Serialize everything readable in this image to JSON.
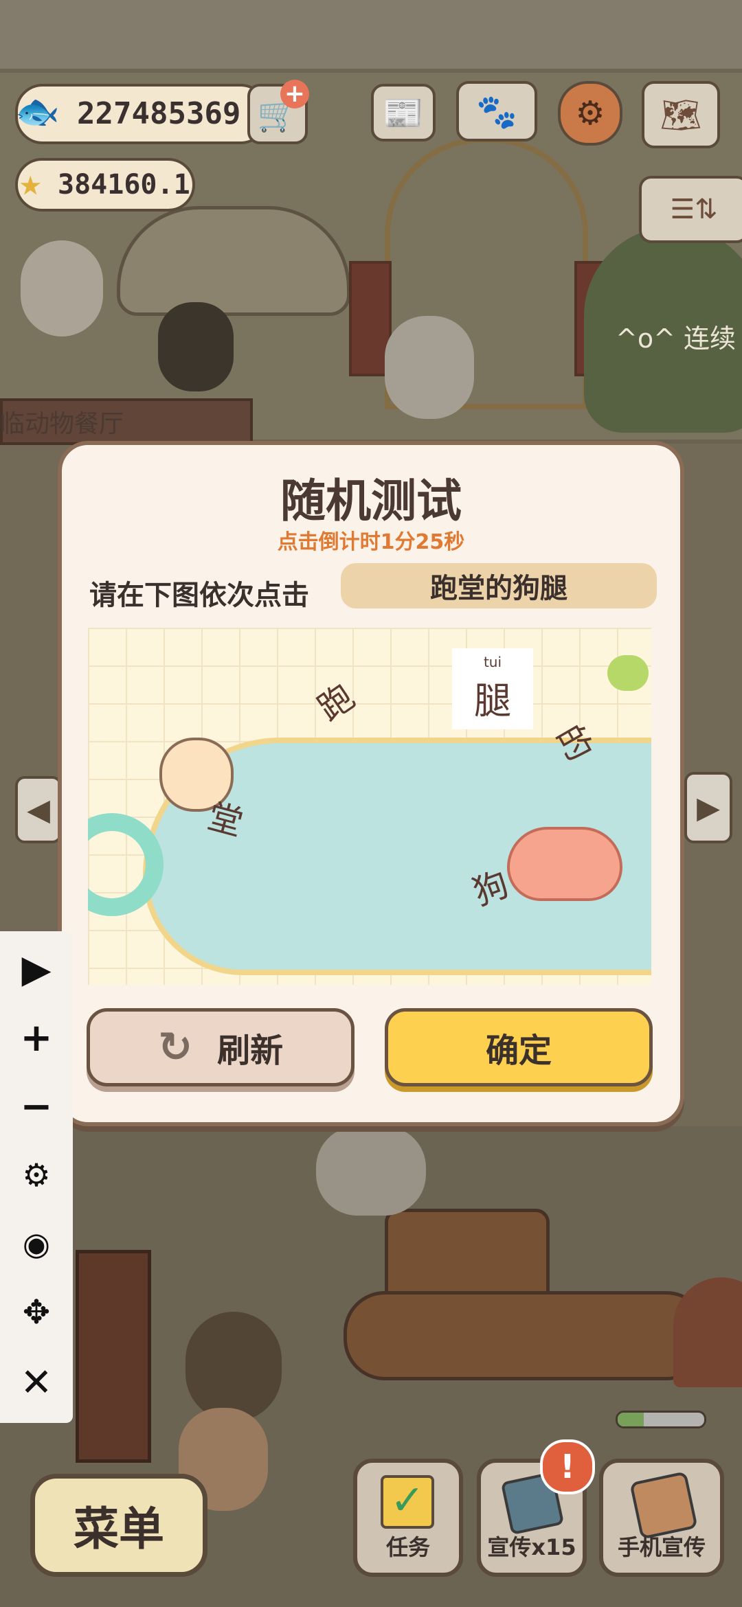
{
  "hud": {
    "fish_count": "227485369",
    "star_count": "384160.1",
    "side_text": "^o^ 连续",
    "restaurant_sign": "临动物餐厅"
  },
  "dialog": {
    "title": "随机测试",
    "countdown": "点击倒计时1分25秒",
    "prompt": "请在下图依次点击",
    "target": "跑堂的狗腿",
    "captcha_chars": [
      {
        "char": "腿",
        "pinyin": "tui"
      },
      {
        "char": "跑"
      },
      {
        "char": "的"
      },
      {
        "char": "堂"
      },
      {
        "char": "狗"
      }
    ],
    "refresh_label": "刷新",
    "confirm_label": "确定"
  },
  "bottom": {
    "menu_label": "菜单",
    "tasks_label": "任务",
    "promote_label": "宣传x15",
    "phone_promote_label": "手机宣传"
  },
  "toolbar": [
    "play-icon",
    "plus-icon",
    "minus-icon",
    "gear-icon",
    "eye-icon",
    "move-icon",
    "close-icon"
  ]
}
